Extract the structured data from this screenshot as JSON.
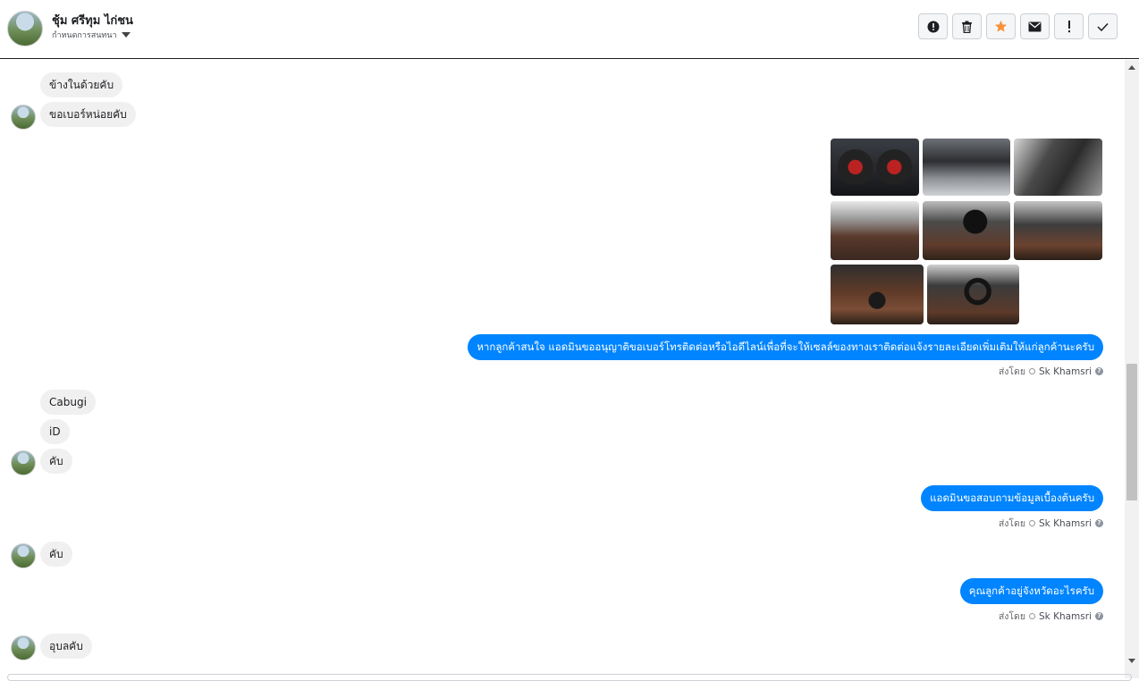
{
  "header": {
    "contact_name": "ชุ้ม ศรีทุม ไก่ชน",
    "subtitle": "กำหนดการสนทนา",
    "toolbar_icons": [
      "report-icon",
      "trash-icon",
      "star-icon",
      "mail-icon",
      "exclamation-icon",
      "check-icon"
    ],
    "star_color": "#f7923b"
  },
  "messages": {
    "m1": "ข้างในด้วยคับ",
    "m2": "ขอเบอร์หน่อยคับ",
    "m3": "หากลูกค้าสนใจ แอดมินขออนุญาติขอเบอร์โทรติดต่อหรือไอดีไลน์เพื่อที่จะให้เซลล์ของทางเราติดต่อแจ้งรายละเอียดเพิ่มเติมให้แก่ลูกค้านะครับ",
    "m4": "Cabugi",
    "m5": "iD",
    "m6": "คับ",
    "m7": "แอดมินขอสอบถามข้อมูลเบื้องต้นครับ",
    "m8": "คับ",
    "m9": "คุณลูกค้าอยู่จังหวัดอะไรครับ",
    "m10": "อุบลคับ"
  },
  "sent_by": {
    "prefix": "ส่งโดย",
    "agent": "Sk Khamsri",
    "help": "?"
  },
  "colors": {
    "outgoing_bubble": "#0084ff",
    "incoming_bubble": "#f1f0f0"
  }
}
